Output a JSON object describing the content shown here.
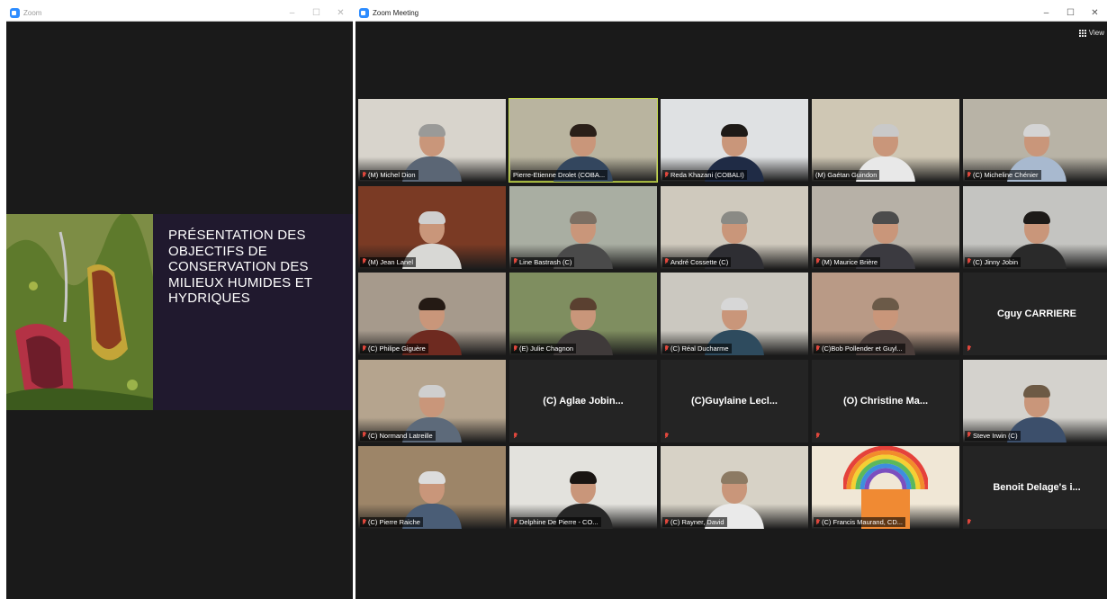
{
  "share_window": {
    "title": "Zoom",
    "controls": [
      "–",
      "☐",
      "✕"
    ],
    "slide_title_lines": [
      "PRÉSENTATION DES",
      "OBJECTIFS DE",
      "CONSERVATION DES",
      "MILIEUX HUMIDES ET",
      "HYDRIQUES"
    ]
  },
  "meeting_window": {
    "title": "Zoom Meeting",
    "controls": [
      "–",
      "☐",
      "✕"
    ],
    "view_label": "View"
  },
  "colors": {
    "active_speaker_border": "#c4da4b",
    "muted_icon": "#e0473c",
    "slide_background": "#20192e"
  },
  "participants": [
    {
      "name": "(M) Michel Dion",
      "muted": true,
      "video": true,
      "scene": "#d8d4cc",
      "body": "#5b6675",
      "hair": "#9a9a98"
    },
    {
      "name": "Pierre-Etienne Drolet (COBA...",
      "muted": false,
      "video": true,
      "active": true,
      "scene": "#b9b49f",
      "body": "#33465e",
      "hair": "#2a1f18"
    },
    {
      "name": "Reda Khazani (COBALI)",
      "muted": true,
      "video": true,
      "scene": "#dfe1e3",
      "body": "#1f2b45",
      "hair": "#1e1a17"
    },
    {
      "name": "(M) Gaétan Guindon",
      "muted": false,
      "video": true,
      "scene": "#cfc7b4",
      "body": "#e8e8e8",
      "hair": "#c9c9c9"
    },
    {
      "name": "(C) Micheline Chénier",
      "muted": true,
      "video": true,
      "scene": "#b8b3a6",
      "body": "#a8b9cf",
      "hair": "#d4d4d4"
    },
    {
      "name": "(M) Jean Lanel",
      "muted": true,
      "video": true,
      "scene": "#7a3a24",
      "body": "#d8d8d5",
      "hair": "#cfcfcf"
    },
    {
      "name": "Line Bastrash (C)",
      "muted": true,
      "video": true,
      "scene": "#a9aea2",
      "body": "#4a4a4a",
      "hair": "#7c6f63"
    },
    {
      "name": "André Cossette (C)",
      "muted": true,
      "video": true,
      "scene": "#cfc9bd",
      "body": "#2e2e33",
      "hair": "#8a8a85"
    },
    {
      "name": "(M) Maurice Brière",
      "muted": true,
      "video": true,
      "scene": "#b7b1a7",
      "body": "#3b3a40",
      "hair": "#4c4c4c"
    },
    {
      "name": "(C) Jinny Jobin",
      "muted": true,
      "video": true,
      "scene": "#c4c4c1",
      "body": "#2a2a2a",
      "hair": "#1d1a18"
    },
    {
      "name": "(C) Philipe Giguère",
      "muted": true,
      "video": true,
      "scene": "#a69a8c",
      "body": "#6e2a20",
      "hair": "#241a14"
    },
    {
      "name": "(E) Julie Chagnon",
      "muted": true,
      "video": true,
      "scene": "#7f8e60",
      "body": "#3f3a3a",
      "hair": "#5a4030"
    },
    {
      "name": "(C) Réal Ducharme",
      "muted": true,
      "video": true,
      "scene": "#cbc8c0",
      "body": "#2e4b5e",
      "hair": "#d7d7d7"
    },
    {
      "name": "(C)Bob Pollender et Guyl...",
      "muted": true,
      "video": true,
      "scene": "#b99a86",
      "body": "#4a3d3a",
      "hair": "#6b5a48"
    },
    {
      "name": "Cguy CARRIERE",
      "muted": true,
      "video": false
    },
    {
      "name": "(C) Normand Latreille",
      "muted": true,
      "video": true,
      "scene": "#b5a48e",
      "body": "#5d6a7a",
      "hair": "#cfcfcf"
    },
    {
      "name": "(C) Aglae Jobin...",
      "muted": true,
      "video": false
    },
    {
      "name": "(C)Guylaine Lecl...",
      "muted": true,
      "video": false
    },
    {
      "name": "(O) Christine Ma...",
      "muted": true,
      "video": false
    },
    {
      "name": "Steve Irwin (C)",
      "muted": true,
      "video": true,
      "scene": "#d4d2cd",
      "body": "#3c4f6b",
      "hair": "#6d5a45"
    },
    {
      "name": "(C) Pierre Raiche",
      "muted": true,
      "video": true,
      "scene": "#9d8568",
      "body": "#4a5d76",
      "hair": "#dcdcdc"
    },
    {
      "name": "Delphine De Pierre - CO...",
      "muted": true,
      "video": true,
      "scene": "#e3e2dd",
      "body": "#262626",
      "hair": "#1a1512"
    },
    {
      "name": "(C) Rayner, David",
      "muted": true,
      "video": true,
      "scene": "#d7d2c6",
      "body": "#eaeaea",
      "hair": "#8c7a63"
    },
    {
      "name": "(C) Francis Maurand, CD...",
      "muted": true,
      "video": true,
      "scene": "#f0e7d6",
      "body": "#f08a33",
      "hair": "#ee7733",
      "rainbow": true
    },
    {
      "name": "Benoit Delage's i...",
      "muted": true,
      "video": false
    }
  ]
}
